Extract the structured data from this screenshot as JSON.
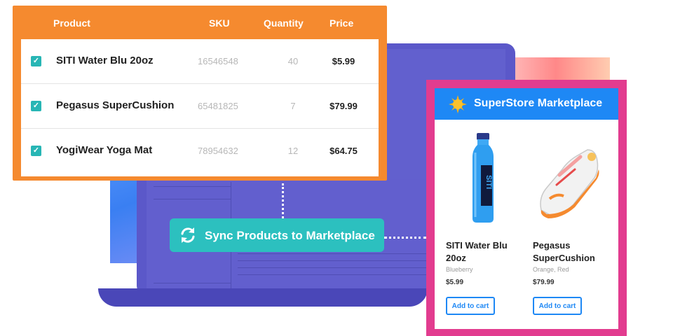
{
  "table": {
    "headers": {
      "product": "Product",
      "sku": "SKU",
      "quantity": "Quantity",
      "price": "Price"
    },
    "rows": [
      {
        "checked": true,
        "product": "SITI Water Blu 20oz",
        "sku": "16546548",
        "quantity": "40",
        "price": "$5.99"
      },
      {
        "checked": true,
        "product": "Pegasus SuperCushion",
        "sku": "65481825",
        "quantity": "7",
        "price": "$79.99"
      },
      {
        "checked": true,
        "product": "YogiWear Yoga Mat",
        "sku": "78954632",
        "quantity": "12",
        "price": "$64.75"
      }
    ]
  },
  "sync_button": {
    "label": "Sync Products to Marketplace",
    "icon": "sync-icon"
  },
  "marketplace": {
    "title": "SuperStore Marketplace",
    "logo_icon": "sun-icon",
    "items": [
      {
        "name": "SITI Water Blu 20oz",
        "variant": "Blueberry",
        "price": "$5.99",
        "button": "Add to cart",
        "image": "water-bottle"
      },
      {
        "name": "Pegasus SuperCushion",
        "variant": "Orange, Red",
        "price": "$79.99",
        "button": "Add to cart",
        "image": "sneaker"
      }
    ]
  },
  "colors": {
    "table_accent": "#f58a2f",
    "checkbox": "#28b6b5",
    "sync_button": "#2cc0bf",
    "marketplace_border": "#e23c8f",
    "marketplace_header": "#1e88f5",
    "laptop": "#5b58c9"
  }
}
